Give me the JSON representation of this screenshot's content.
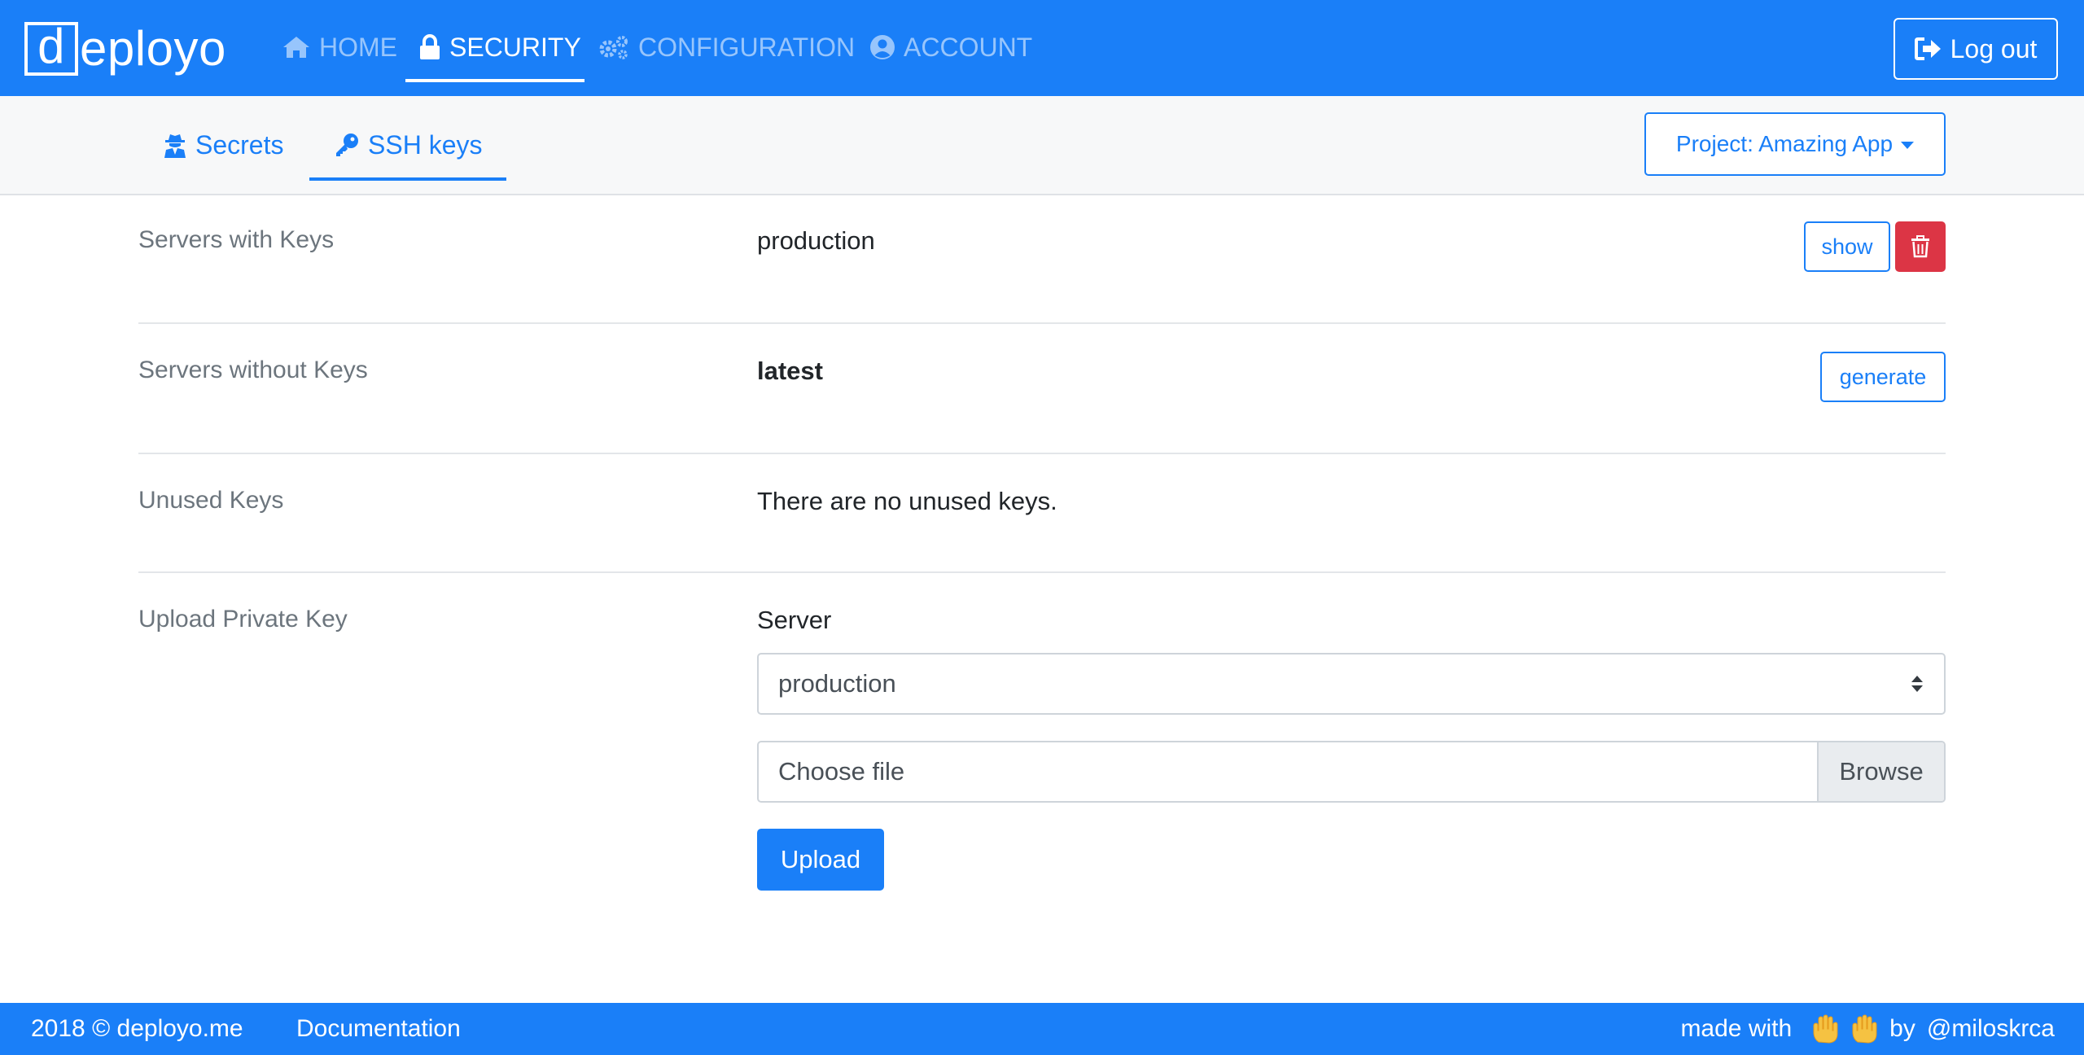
{
  "app": {
    "logo_initial": "d",
    "logo_rest": "eployo"
  },
  "nav": {
    "items": [
      {
        "label": "HOME",
        "icon": "home-icon",
        "active": false
      },
      {
        "label": "SECURITY",
        "icon": "lock-icon",
        "active": true
      },
      {
        "label": "CONFIGURATION",
        "icon": "cogs-icon",
        "active": false
      },
      {
        "label": "ACCOUNT",
        "icon": "user-circle-icon",
        "active": false
      }
    ],
    "logout_label": "Log out"
  },
  "subnav": {
    "tabs": [
      {
        "label": "Secrets",
        "icon": "user-secret-icon",
        "active": false
      },
      {
        "label": "SSH keys",
        "icon": "key-icon",
        "active": true
      }
    ],
    "project_label": "Project: Amazing App"
  },
  "sections": {
    "with_keys": {
      "label": "Servers with Keys",
      "server": "production",
      "show_label": "show"
    },
    "without_keys": {
      "label": "Servers without Keys",
      "server": "latest",
      "generate_label": "generate"
    },
    "unused": {
      "label": "Unused Keys",
      "message": "There are no unused keys."
    },
    "upload": {
      "label": "Upload Private Key",
      "server_label": "Server",
      "selected_server": "production",
      "file_placeholder": "Choose file",
      "browse_label": "Browse",
      "upload_label": "Upload"
    }
  },
  "footer": {
    "copyright": "2018 © deployo.me",
    "documentation": "Documentation",
    "made_with": "made with",
    "by": "by",
    "author": "@miloskrca"
  },
  "colors": {
    "primary": "#1a7ff8",
    "danger": "#dc3545",
    "muted": "#6c757d"
  }
}
